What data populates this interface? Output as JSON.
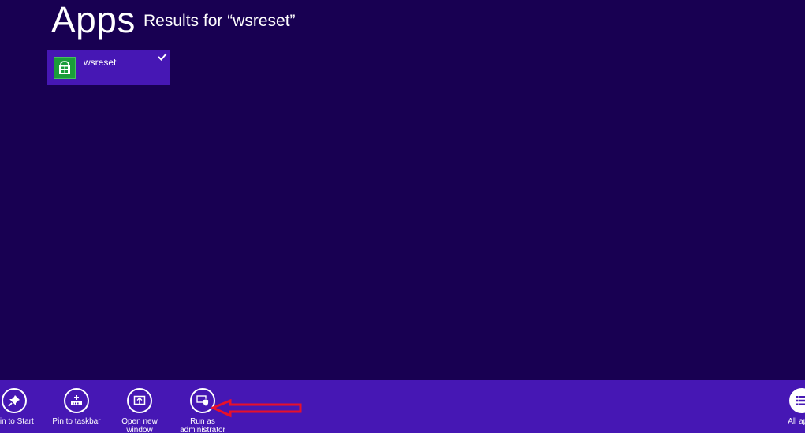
{
  "page": {
    "title": "Apps",
    "results_label": "Results for “wsreset”"
  },
  "results": [
    {
      "name": "wsreset",
      "icon": "store-icon",
      "selected": true
    }
  ],
  "app_bar": {
    "commands": [
      {
        "id": "pin-to-start",
        "label": "Pin to Start",
        "icon": "pin-icon"
      },
      {
        "id": "pin-to-taskbar",
        "label": "Pin to taskbar",
        "icon": "taskbar-pin-icon"
      },
      {
        "id": "open-new-window",
        "label": "Open new\nwindow",
        "icon": "new-window-icon"
      },
      {
        "id": "run-as-administrator",
        "label": "Run as\nadministrator",
        "icon": "shield-icon"
      },
      {
        "id": "all-apps",
        "label": "All apps",
        "icon": "list-icon"
      }
    ]
  },
  "colors": {
    "background": "#180052",
    "accent": "#4617b4",
    "tile_icon": "#1a9c3a",
    "annotation_arrow": "#e8102a"
  }
}
